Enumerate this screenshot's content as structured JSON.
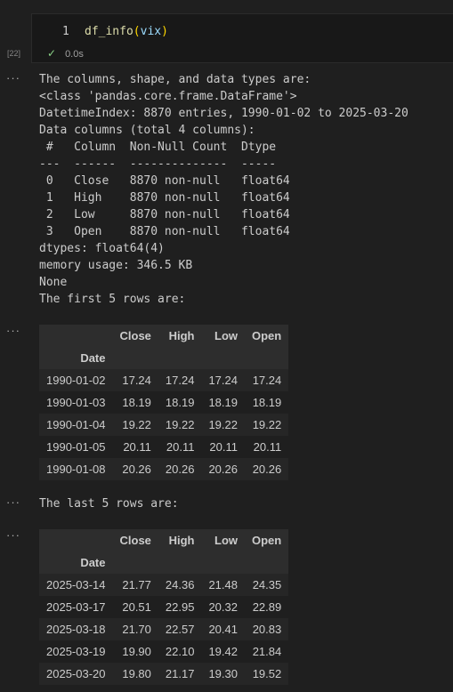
{
  "cell": {
    "line_number": "1",
    "code_func": "df_info",
    "code_open": "(",
    "code_arg": "vix",
    "code_close": ")",
    "check_glyph": "✓",
    "exec_time": "0.0s",
    "exec_count": "[22]"
  },
  "output_menu_glyph": "···",
  "info_output": "The columns, shape, and data types are:\n<class 'pandas.core.frame.DataFrame'>\nDatetimeIndex: 8870 entries, 1990-01-02 to 2025-03-20\nData columns (total 4 columns):\n #   Column  Non-Null Count  Dtype  \n---  ------  --------------  -----  \n 0   Close   8870 non-null   float64\n 1   High    8870 non-null   float64\n 2   Low     8870 non-null   float64\n 3   Open    8870 non-null   float64\ndtypes: float64(4)\nmemory usage: 346.5 KB\nNone\nThe first 5 rows are:",
  "last_rows_text": "The last 5 rows are:",
  "first_table": {
    "columns": [
      "Close",
      "High",
      "Low",
      "Open"
    ],
    "index_name": "Date",
    "rows": [
      {
        "date": "1990-01-02",
        "values": [
          "17.24",
          "17.24",
          "17.24",
          "17.24"
        ]
      },
      {
        "date": "1990-01-03",
        "values": [
          "18.19",
          "18.19",
          "18.19",
          "18.19"
        ]
      },
      {
        "date": "1990-01-04",
        "values": [
          "19.22",
          "19.22",
          "19.22",
          "19.22"
        ]
      },
      {
        "date": "1990-01-05",
        "values": [
          "20.11",
          "20.11",
          "20.11",
          "20.11"
        ]
      },
      {
        "date": "1990-01-08",
        "values": [
          "20.26",
          "20.26",
          "20.26",
          "20.26"
        ]
      }
    ]
  },
  "last_table": {
    "columns": [
      "Close",
      "High",
      "Low",
      "Open"
    ],
    "index_name": "Date",
    "rows": [
      {
        "date": "2025-03-14",
        "values": [
          "21.77",
          "24.36",
          "21.48",
          "24.35"
        ]
      },
      {
        "date": "2025-03-17",
        "values": [
          "20.51",
          "22.95",
          "20.32",
          "22.89"
        ]
      },
      {
        "date": "2025-03-18",
        "values": [
          "21.70",
          "22.57",
          "20.41",
          "20.83"
        ]
      },
      {
        "date": "2025-03-19",
        "values": [
          "19.90",
          "22.10",
          "19.42",
          "21.84"
        ]
      },
      {
        "date": "2025-03-20",
        "values": [
          "19.80",
          "21.17",
          "19.30",
          "19.52"
        ]
      }
    ]
  }
}
